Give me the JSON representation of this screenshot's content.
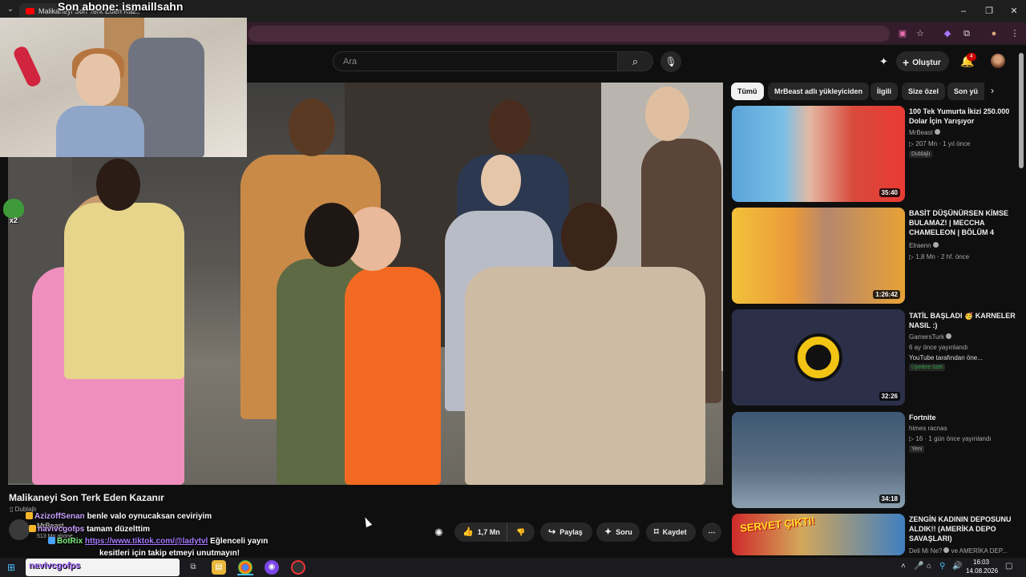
{
  "browser": {
    "tab_title": "Malikaneyi Son Terk Eden Kaz...",
    "window_controls": [
      "–",
      "❐",
      "✕"
    ]
  },
  "overlay": {
    "subscriber_banner": "Son abone: ismaillsahn",
    "pepe_count": "x2",
    "chat": [
      {
        "user": "AzizoffSenan",
        "message": "benle valo oynucaksan ceviriyim"
      },
      {
        "user": "navivcgofps",
        "message": "tamam düzelttim"
      },
      {
        "user": "BotRix",
        "link": "https://www.tiktok.com/@ladytvl",
        "message": "Eğlenceli yayın"
      },
      {
        "message": "kesitleri için takip etmeyi unutmayın!"
      }
    ]
  },
  "header": {
    "search_placeholder": "Ara",
    "search_icon": "search-icon",
    "mic_icon": "mic-icon",
    "create_label": "Oluştur",
    "notification_count": "4"
  },
  "video": {
    "title": "Malikaneyi Son Terk Eden Kazanır",
    "dubbed_label": "Dublajlı",
    "channel": "MrBeast",
    "subscribers": "513 Mn abone",
    "actions": {
      "like_count": "1,7 Mn",
      "share_label": "Paylaş",
      "ask_label": "Soru",
      "save_label": "Kaydet"
    }
  },
  "filters": {
    "chips": [
      "Tümü",
      "MrBeast adlı yükleyiciden",
      "İlgili",
      "Size özel",
      "Son yü"
    ]
  },
  "recommendations": [
    {
      "title": "100 Tek Yumurta İkizi 250.000 Dolar İçin Yarışıyor",
      "channel": "MrBeast",
      "views": "207 Mn",
      "age": "1 yıl önce",
      "badge": "Dublajlı",
      "duration": "35:40"
    },
    {
      "title": "BASİT DÜŞÜNÜRSEN KİMSE BULAMAZ! | MECCHA CHAMELEON | BÖLÜM 4",
      "channel": "Elraenn",
      "views": "1,8 Mn",
      "age": "2 hf. önce",
      "duration": "1:26:42"
    },
    {
      "title": "TATİL BAŞLADI 🥳 KARNELER NASIL :)",
      "channel": "GamersTurk",
      "age": "6 ay önce yayınlandı",
      "note": "YouTube tarafından öne...",
      "badge": "Üyelere özel",
      "duration": "32:26"
    },
    {
      "title": "Fortnite",
      "channel": "himes racnas",
      "views": "16",
      "age": "1 gün önce yayınlandı",
      "badge": "Yeni",
      "duration": "34:18"
    },
    {
      "title": "ZENGİN KADININ DEPOSUNU ALDIK!! (AMERİKA DEPO SAVAŞLARI)",
      "channel": "Deli Mi Ne?",
      "channel_extra": "ve AMERİKA DEP...",
      "thumb_text": "SERVET ÇIKTI!"
    }
  ],
  "taskbar": {
    "search_text": "navivcgofps",
    "time": "16:03",
    "date": "14.08.2026"
  }
}
